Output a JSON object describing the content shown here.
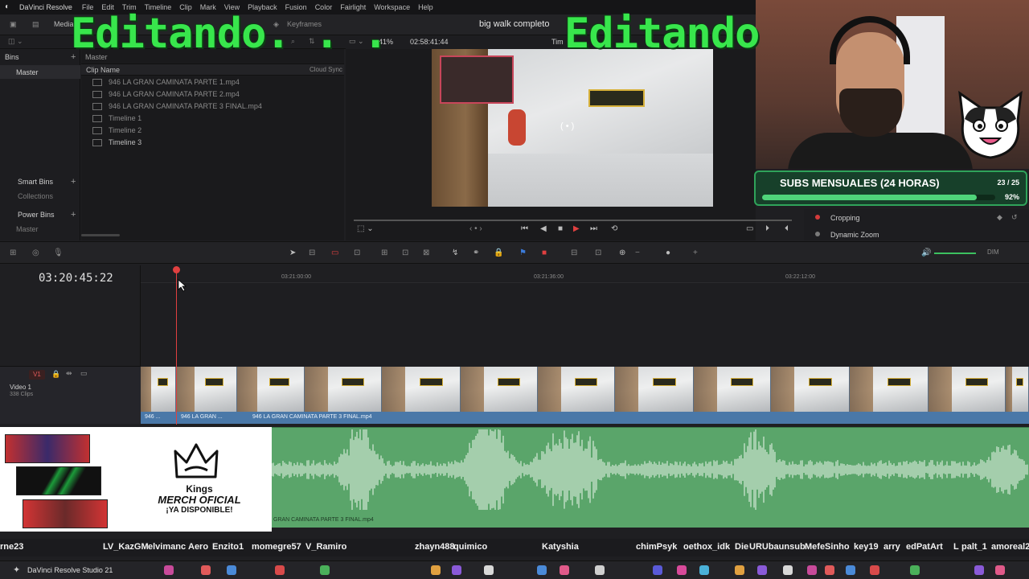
{
  "menu": {
    "app": "DaVinci Resolve",
    "items": [
      "File",
      "Edit",
      "Trim",
      "Timeline",
      "Clip",
      "Mark",
      "View",
      "Playback",
      "Fusion",
      "Color",
      "Fairlight",
      "Workspace",
      "Help"
    ]
  },
  "toolbar": {
    "media_pool": "Media",
    "keyframes": "Keyframes",
    "zoom": "41%",
    "timecode": "02:58:41:44",
    "timeline_name": "big walk completo",
    "timecode_label": "Tim"
  },
  "overlay": {
    "left_text": "Editando. . .",
    "right_text": "Editando"
  },
  "bins": {
    "header": "Bins",
    "master": "Master",
    "smart_bins": "Smart Bins",
    "collections": "Collections",
    "power_bins": "Power Bins",
    "power_master": "Master"
  },
  "media": {
    "breadcrumb": "Master",
    "col_name": "Clip Name",
    "col_sync": "Cloud Sync",
    "rows": [
      "946 LA GRAN CAMINATA PARTE 1.mp4",
      "946 LA GRAN CAMINATA PARTE 2.mp4",
      "946 LA GRAN CAMINATA PARTE 3 FINAL.mp4",
      "Timeline 1",
      "Timeline 2",
      "Timeline 3"
    ]
  },
  "inspector": {
    "cropping": "Cropping",
    "dynamic_zoom": "Dynamic Zoom"
  },
  "timeline": {
    "timecode": "03:20:45:22",
    "ruler": [
      "03:21:00:00",
      "03:21:36:00",
      "03:22:12:00"
    ],
    "track_tag": "V1",
    "track_name": "Video 1",
    "track_clips": "338 Clips",
    "clip_labels": [
      "946 ...",
      "946 LA GRAN ...",
      "946 LA GRAN CAMINATA PARTE 3 FINAL.mp4"
    ],
    "audio_label": "GRAN CAMINATA PARTE 3 FINAL.mp4",
    "dim": "DIM"
  },
  "subs": {
    "title": "SUBS MENSUALES (24 HORAS)",
    "count": "23 / 25",
    "percent": "92%",
    "progress": 0.92
  },
  "merch": {
    "brand": "Kings",
    "line1": "MERCH OFICIAL",
    "line2": "¡YA DISPONIBLE!"
  },
  "chat": [
    "rne23",
    "LV_KazGM",
    "elvimanc",
    "Aero",
    "Enzito1",
    "momegre57",
    "V_Ramiro",
    "zhayn488",
    "quimico",
    "Katyshia",
    "chimPsyk",
    "oethox_idk",
    "Die",
    "URUbaunsub",
    "MefeSinho",
    "key19",
    "arry",
    "edPatArt",
    "L",
    "palt_1",
    "amoreal2"
  ],
  "taskbar": {
    "app": "DaVinci Resolve Studio 21"
  }
}
